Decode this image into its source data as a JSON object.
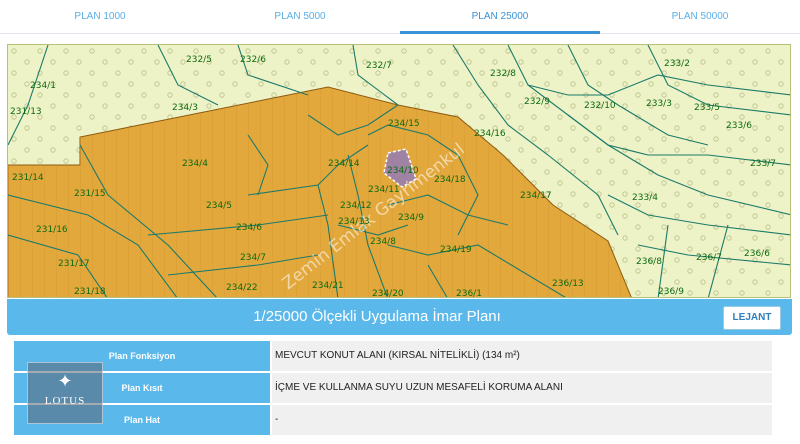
{
  "tabs": [
    {
      "label": "PLAN 1000",
      "active": false
    },
    {
      "label": "PLAN 5000",
      "active": false
    },
    {
      "label": "PLAN 25000",
      "active": true
    },
    {
      "label": "PLAN 50000",
      "active": false
    }
  ],
  "map": {
    "parcel_labels": [
      "232/5",
      "232/6",
      "232/7",
      "232/8",
      "233/2",
      "234/1",
      "234/3",
      "232/9",
      "232/10",
      "233/3",
      "233/5",
      "231/13",
      "234/15",
      "234/16",
      "233/6",
      "234/4",
      "234/14",
      "234/18",
      "233/7",
      "231/14",
      "231/15",
      "234/5",
      "234/17",
      "234/11",
      "234/12",
      "233/4",
      "231/16",
      "234/6",
      "234/13",
      "234/9",
      "234/8",
      "234/7",
      "234/19",
      "236/8",
      "236/7",
      "236/6",
      "231/17",
      "234/22",
      "234/21",
      "234/20",
      "236/1",
      "236/13",
      "231/18",
      "236/9"
    ],
    "highlight_parcel": "234/10",
    "watermark": "Zemin Emlak Gayrimenkul"
  },
  "title_bar": {
    "title": "1/25000 Ölçekli Uygulama İmar Planı",
    "legend_button": "LEJANT"
  },
  "info_rows": [
    {
      "label": "Plan Fonksiyon",
      "value": "MEVCUT KONUT ALANI (KIRSAL NİTELİKLİ) (134 m²)"
    },
    {
      "label": "Plan Kısıt",
      "value": "İÇME VE KULLANMA SUYU UZUN MESAFELİ KORUMA ALANI"
    },
    {
      "label": "Plan Hat",
      "value": "-"
    }
  ],
  "logo": {
    "mark": "✦",
    "text": "LOTUS"
  },
  "colors": {
    "accent": "#5bb8ea",
    "tab_text": "#5aaee8",
    "map_background": "#eef3c7",
    "residential_fill": "#e3a83c",
    "label_green": "#0c6a12",
    "highlight_fill": "#8a76c4"
  }
}
